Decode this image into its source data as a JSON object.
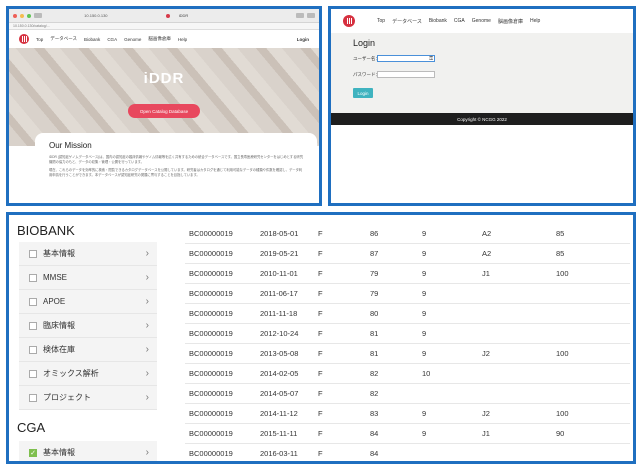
{
  "browser": {
    "url": "10.150.0.130",
    "tab_title": "iDDR",
    "address_line": "10.150.0.130/catalog/..."
  },
  "nav": {
    "items": [
      "Top",
      "データベース",
      "Biobank",
      "CGA",
      "Genome",
      "脳画像倉庫",
      "Help"
    ],
    "login": "Login"
  },
  "hero": {
    "logo_text": "iDDR",
    "button": "Open Catalog Database"
  },
  "mission": {
    "title": "Our Mission",
    "text1": "iDDR (認知症ゲノムデータベース)は、国内の認知症の臨床情報やゲノム情報等を広く共有するための統合データベースです。国立長寿医療研究センターをはじめとする研究機関の協力のもと、データの収集・管理・公開を行っています。",
    "text2": "現在、これらのデータを効率的に検索・閲覧できるカタログデータベースを公開しています。研究者はカタログを通じて利用可能なデータの種類や件数を確認し、データ利用申請を行うことができます。本データベースが認知症研究の発展に寄与することを目指しています。"
  },
  "login_panel": {
    "nav": [
      "Top",
      "データベース",
      "Biobank",
      "CGA",
      "Genome",
      "脳画像倉庫",
      "Help"
    ],
    "title": "Login",
    "username_label": "ユーザー名：",
    "password_label": "パスワード：",
    "username_value": "",
    "password_value": "",
    "button": "Login",
    "footer": "Copyright © NCGG 2022"
  },
  "biobank": {
    "title": "BIOBANK",
    "items": [
      "基本情報",
      "MMSE",
      "APOE",
      "臨床情報",
      "検体在庫",
      "オミックス解析",
      "プロジェクト"
    ]
  },
  "cga": {
    "title": "CGA",
    "items": [
      {
        "label": "基本情報",
        "checked": true
      }
    ]
  },
  "table": {
    "rows": [
      [
        "BC00000019",
        "2018-05-01",
        "F",
        "86",
        "9",
        "A2",
        "85"
      ],
      [
        "BC00000019",
        "2019-05-21",
        "F",
        "87",
        "9",
        "A2",
        "85"
      ],
      [
        "BC00000019",
        "2010-11-01",
        "F",
        "79",
        "9",
        "J1",
        "100"
      ],
      [
        "BC00000019",
        "2011-06-17",
        "F",
        "79",
        "9",
        "",
        ""
      ],
      [
        "BC00000019",
        "2011-11-18",
        "F",
        "80",
        "9",
        "",
        ""
      ],
      [
        "BC00000019",
        "2012-10-24",
        "F",
        "81",
        "9",
        "",
        ""
      ],
      [
        "BC00000019",
        "2013-05-08",
        "F",
        "81",
        "9",
        "J2",
        "100"
      ],
      [
        "BC00000019",
        "2014-02-05",
        "F",
        "82",
        "10",
        "",
        ""
      ],
      [
        "BC00000019",
        "2014-05-07",
        "F",
        "82",
        "",
        "",
        ""
      ],
      [
        "BC00000019",
        "2014-11-12",
        "F",
        "83",
        "9",
        "J2",
        "100"
      ],
      [
        "BC00000019",
        "2015-11-11",
        "F",
        "84",
        "9",
        "J1",
        "90"
      ],
      [
        "BC00000019",
        "2016-03-11",
        "F",
        "84",
        "",
        "",
        ""
      ]
    ]
  },
  "colors": {
    "panel_border": "#1f6fc0",
    "brand_red": "#d6303f",
    "cta_pink": "#e8485e",
    "login_teal": "#3fb3bf",
    "check_green": "#7fbf4f"
  },
  "icons": [
    "ddr-logo-icon",
    "key-icon",
    "chevron-right-icon",
    "checkbox-icon"
  ]
}
